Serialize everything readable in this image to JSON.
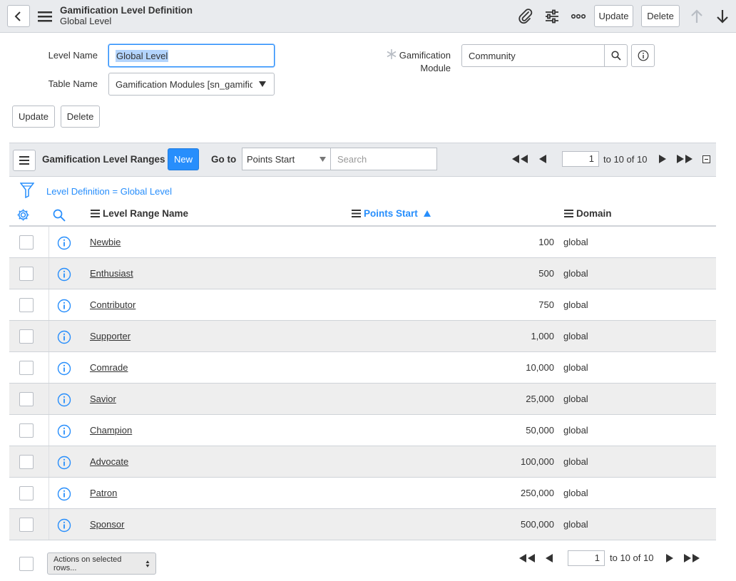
{
  "header": {
    "title": "Gamification Level Definition",
    "subtitle": "Global Level",
    "update_label": "Update",
    "delete_label": "Delete"
  },
  "form": {
    "level_name_label": "Level Name",
    "level_name_value": "Global Level",
    "table_name_label": "Table Name",
    "table_name_value": "Gamification Modules [sn_gamific…",
    "module_label_line1": "Gamification",
    "module_label_line2": "Module",
    "module_value": "Community",
    "update_label": "Update",
    "delete_label": "Delete"
  },
  "list": {
    "title": "Gamification Level Ranges",
    "new_label": "New",
    "goto_label": "Go to",
    "goto_field": "Points Start",
    "search_placeholder": "Search",
    "page_value": "1",
    "page_range": "to 10 of 10",
    "breadcrumb": "Level Definition = Global Level",
    "columns": {
      "name": "Level Range Name",
      "points": "Points Start",
      "domain": "Domain"
    },
    "rows": [
      {
        "name": "Newbie",
        "points": "100",
        "domain": "global"
      },
      {
        "name": "Enthusiast",
        "points": "500",
        "domain": "global"
      },
      {
        "name": "Contributor",
        "points": "750",
        "domain": "global"
      },
      {
        "name": "Supporter",
        "points": "1,000",
        "domain": "global"
      },
      {
        "name": "Comrade",
        "points": "10,000",
        "domain": "global"
      },
      {
        "name": "Savior",
        "points": "25,000",
        "domain": "global"
      },
      {
        "name": "Champion",
        "points": "50,000",
        "domain": "global"
      },
      {
        "name": "Advocate",
        "points": "100,000",
        "domain": "global"
      },
      {
        "name": "Patron",
        "points": "250,000",
        "domain": "global"
      },
      {
        "name": "Sponsor",
        "points": "500,000",
        "domain": "global"
      }
    ]
  },
  "footer": {
    "actions_label": "Actions on selected rows...",
    "page_value": "1",
    "page_range": "to 10 of 10"
  },
  "colors": {
    "accent": "#278efc",
    "header_bg": "#e9ebee",
    "alt_row": "#eeeeee"
  }
}
